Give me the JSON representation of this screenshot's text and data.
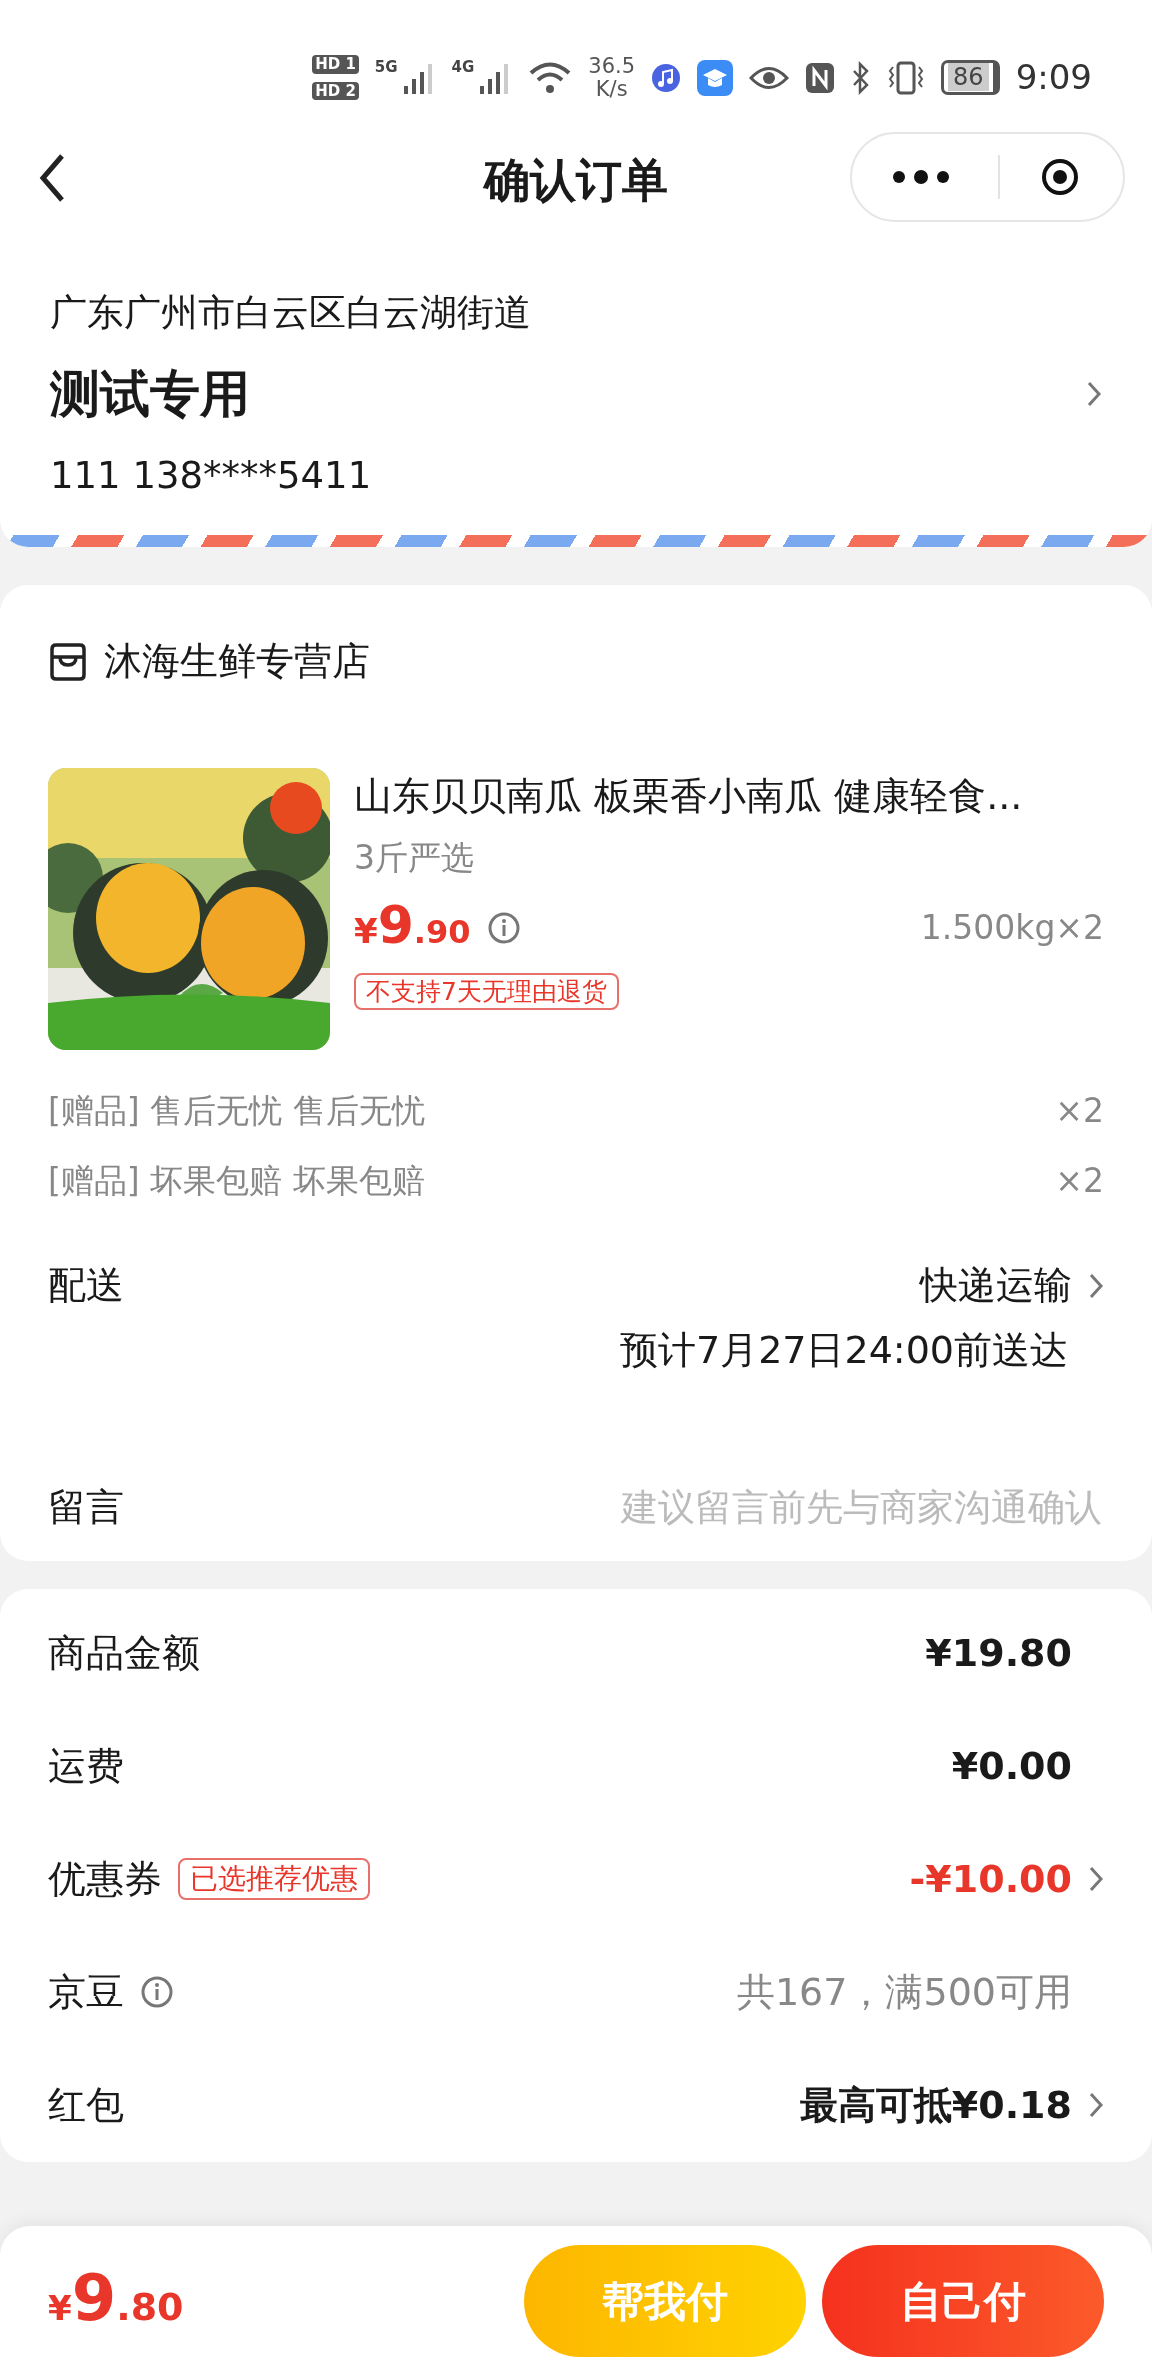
{
  "status_bar": {
    "sim_labels": [
      "HD 1",
      "HD 2"
    ],
    "networks": [
      "5G",
      "4G"
    ],
    "speed": "36.5",
    "speed_unit": "K/s",
    "battery": "86",
    "time": "9:09"
  },
  "nav": {
    "title": "确认订单"
  },
  "address": {
    "line": "广东广州市白云区白云湖街道",
    "name": "测试专用",
    "phone": "111 138****5411"
  },
  "store": {
    "name": "沐海生鲜专营店",
    "product": {
      "kind": "picture",
      "title": "山东贝贝南瓜 板栗香小南瓜 健康轻食...",
      "spec": "3斤严选",
      "price_currency": "¥",
      "price_int": "9",
      "price_dec": ".90",
      "weight": "1.500kg×2",
      "tag": "不支持7天无理由退货"
    },
    "gifts": [
      {
        "label": "[赠品]",
        "text": "售后无忧 售后无忧",
        "qty": "×2"
      },
      {
        "label": "[赠品]",
        "text": "坏果包赔 坏果包赔",
        "qty": "×2"
      }
    ],
    "delivery": {
      "label": "配送",
      "method": "快递运输",
      "eta": "预计7月27日24:00前送达"
    },
    "message": {
      "label": "留言",
      "placeholder": "建议留言前先与商家沟通确认"
    }
  },
  "summary": [
    {
      "label": "商品金额",
      "value": "¥19.80",
      "kind": "normal",
      "info": false,
      "arrow": false
    },
    {
      "label": "运费",
      "value": "¥0.00",
      "kind": "normal",
      "info": false,
      "arrow": false
    },
    {
      "label": "优惠券",
      "tag": "已选推荐优惠",
      "value": "-¥10.00",
      "kind": "discount",
      "info": false,
      "arrow": true
    },
    {
      "label": "京豆",
      "value": "共167，满500可用",
      "kind": "muted",
      "info": true,
      "arrow": false
    },
    {
      "label": "红包",
      "value": "最高可抵¥0.18",
      "kind": "normal",
      "info": false,
      "arrow": true
    }
  ],
  "footer": {
    "currency": "¥",
    "int": "9",
    "dec": ".80",
    "buttons": [
      {
        "label": "帮我付",
        "kind": "secondary"
      },
      {
        "label": "自己付",
        "kind": "primary"
      }
    ]
  }
}
